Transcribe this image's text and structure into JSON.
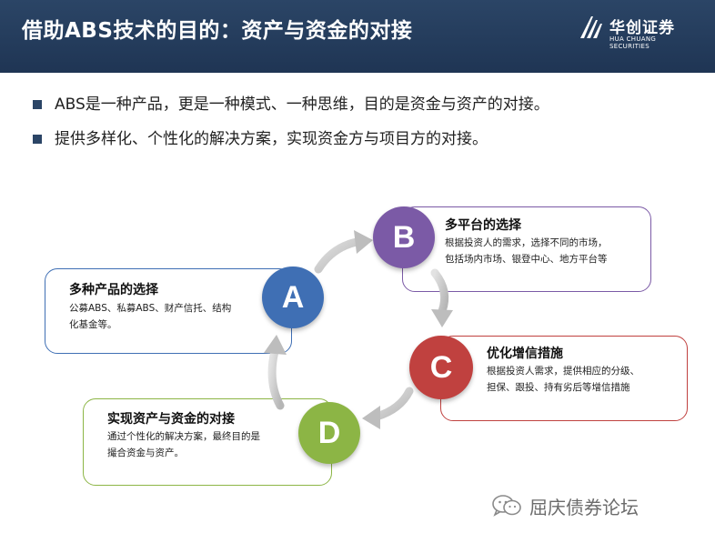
{
  "header": {
    "title": "借助ABS技术的目的：资产与资金的对接",
    "logo_cn": "华创证券",
    "logo_en": "HUA CHUANG SECURITIES"
  },
  "bullets": [
    "ABS是一种产品，更是一种模式、一种思维，目的是资金与资产的对接。",
    "提供多样化、个性化的解决方案，实现资金方与项目方的对接。"
  ],
  "nodes": {
    "A": {
      "letter": "A",
      "title": "多种产品的选择",
      "line1": "公募ABS、私募ABS、财产信托、结构",
      "line2": "化基金等。",
      "color": "#3f6fb4"
    },
    "B": {
      "letter": "B",
      "title": "多平台的选择",
      "line1": "根据投资人的需求，选择不同的市场，",
      "line2": "包括场内市场、银登中心、地方平台等",
      "color": "#7b5aa6"
    },
    "C": {
      "letter": "C",
      "title": "优化增信措施",
      "line1": "根据投资人需求，提供相应的分级、",
      "line2": "担保、跟投、持有劣后等增信措施",
      "color": "#c0413f"
    },
    "D": {
      "letter": "D",
      "title": "实现资产与资金的对接",
      "line1": "通过个性化的解决方案，最终目的是",
      "line2": "撮合资金与资产。",
      "color": "#8cb545"
    }
  },
  "watermark": {
    "text": "屈庆债券论坛",
    "icon": "wechat-icon"
  }
}
